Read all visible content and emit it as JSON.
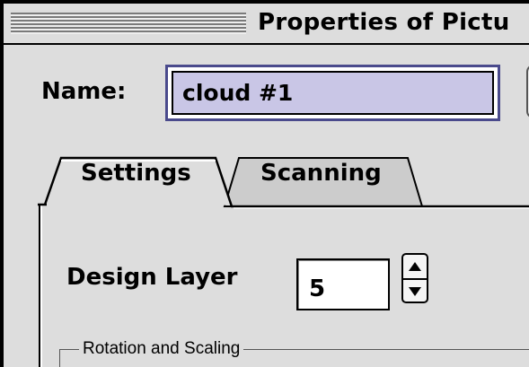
{
  "window": {
    "title": "Properties of Pictu"
  },
  "name_row": {
    "label": "Name:",
    "value": "cloud #1"
  },
  "tabs": [
    {
      "label": "Settings",
      "selected": true
    },
    {
      "label": "Scanning",
      "selected": false
    }
  ],
  "settings": {
    "design_layer_label": "Design Layer",
    "design_layer_value": "5",
    "group_label": "Rotation and Scaling"
  },
  "icons": {
    "stepper_up": "triangle-up-icon",
    "stepper_down": "triangle-down-icon"
  },
  "colors": {
    "window_bg": "#dddddd",
    "name_field_fill": "#c9c6e6",
    "focus_ring": "#4a4a8c"
  }
}
